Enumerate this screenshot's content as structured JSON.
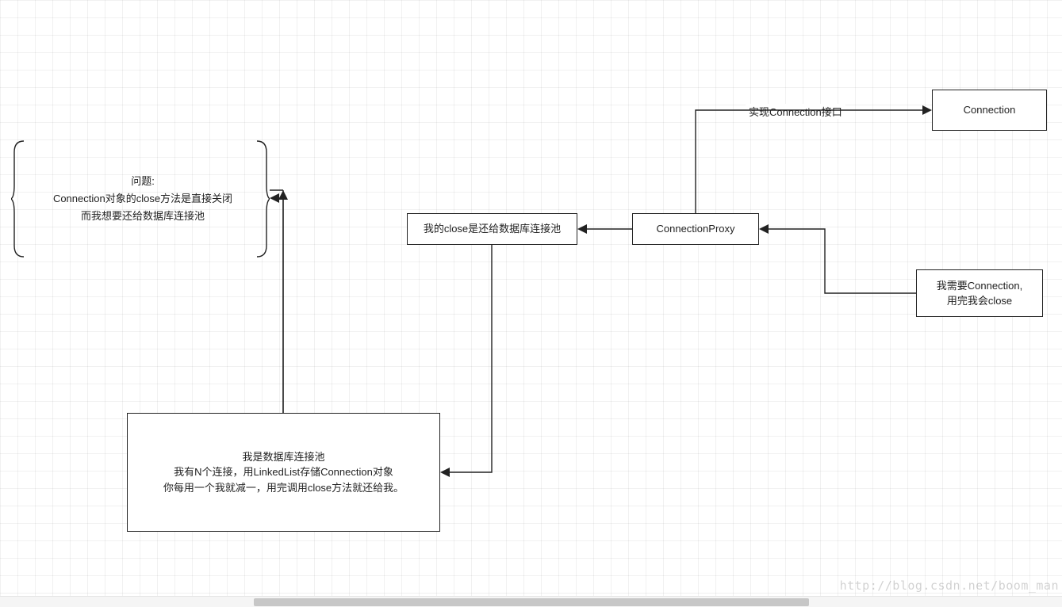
{
  "nodes": {
    "problem": {
      "line1": "问题:",
      "line2": "Connection对象的close方法是直接关闭",
      "line3": "而我想要还给数据库连接池"
    },
    "pool": {
      "line1": "我是数据库连接池",
      "line2": "我有N个连接，用LinkedList存储Connection对象",
      "line3": "你每用一个我就减一，用完调用close方法就还给我。"
    },
    "close": "我的close是还给数据库连接池",
    "proxy": "ConnectionProxy",
    "connection": "Connection",
    "client": {
      "line1": "我需要Connection,",
      "line2": "用完我会close"
    }
  },
  "edges": {
    "implements_label": "实现Connection接口"
  },
  "watermark": "http://blog.csdn.net/boom_man"
}
